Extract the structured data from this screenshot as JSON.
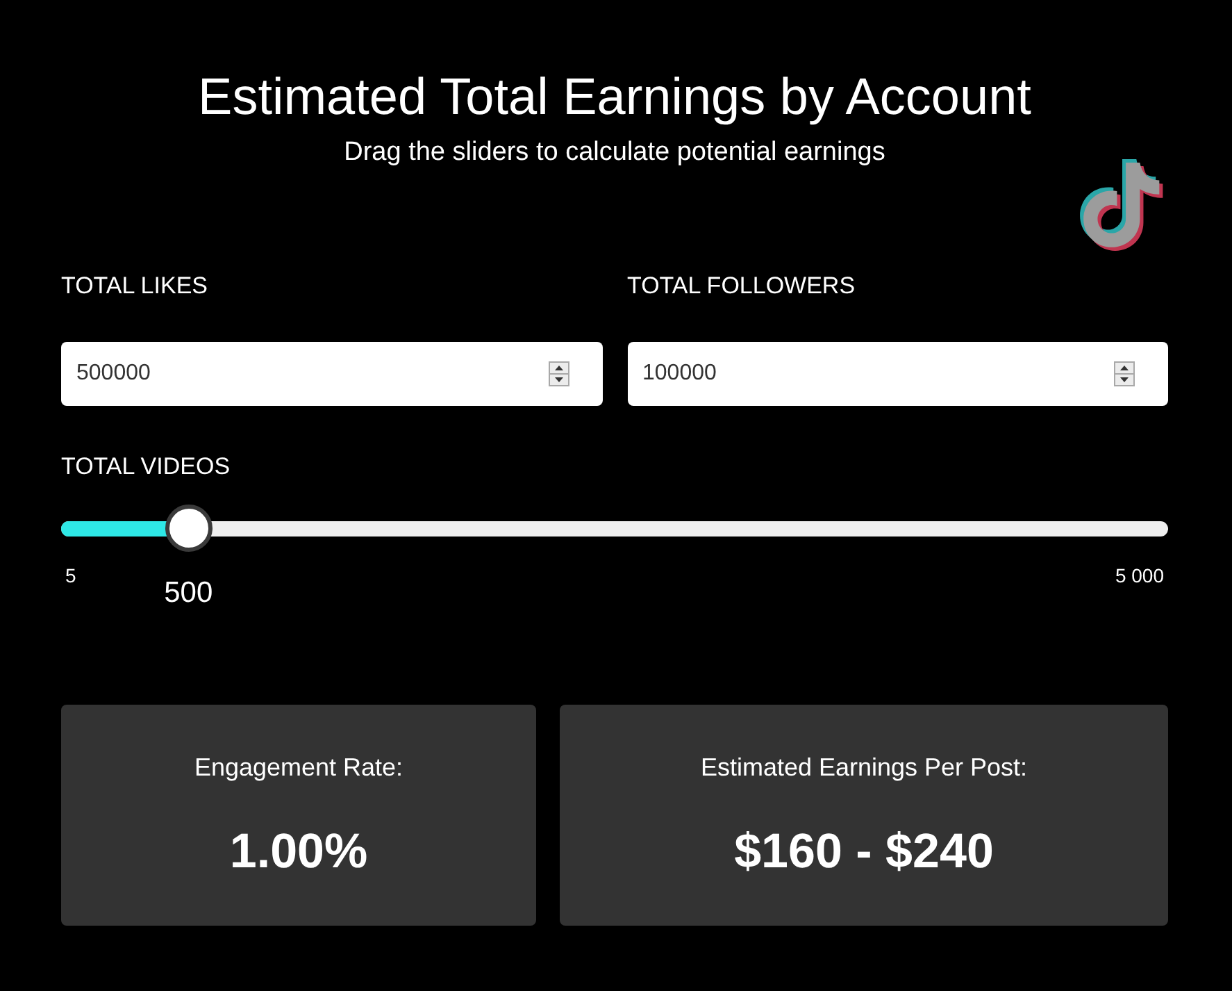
{
  "header": {
    "title": "Estimated Total Earnings by Account",
    "subtitle": "Drag the sliders to calculate potential earnings"
  },
  "fields": [
    {
      "label": "TOTAL LIKES",
      "value": "500000"
    },
    {
      "label": "TOTAL FOLLOWERS",
      "value": "100000"
    }
  ],
  "slider": {
    "label": "TOTAL VIDEOS",
    "min_label": "5",
    "max_label": "5 000",
    "value": "500",
    "level": 0.115
  },
  "results": [
    {
      "label": "Engagement Rate:",
      "value": "1.00%"
    },
    {
      "label": "Estimated Earnings Per Post:",
      "value": "$160 - $240"
    }
  ]
}
